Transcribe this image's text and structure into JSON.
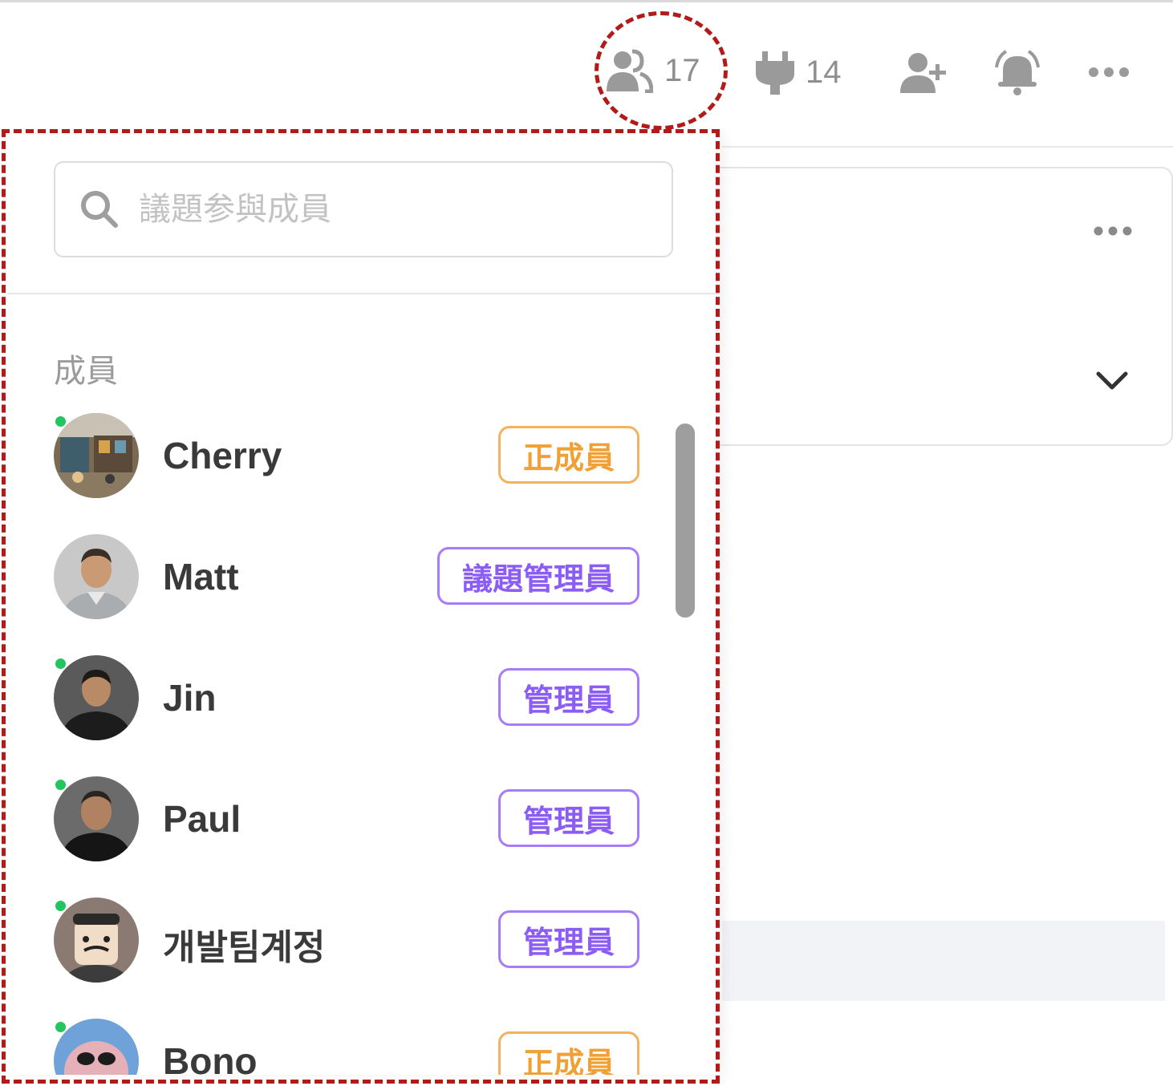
{
  "toolbar": {
    "members_count": "17",
    "integrations_count": "14"
  },
  "search": {
    "placeholder": "議題参與成員"
  },
  "section": {
    "label": "成員"
  },
  "members": [
    {
      "name": "Cherry",
      "role": "正成員",
      "online": true
    },
    {
      "name": "Matt",
      "role": "議題管理員",
      "online": false
    },
    {
      "name": "Jin",
      "role": "管理員",
      "online": true
    },
    {
      "name": "Paul",
      "role": "管理員",
      "online": true
    },
    {
      "name": "개발팀계정",
      "role": "管理員",
      "online": true
    },
    {
      "name": "Bono",
      "role": "正成員",
      "online": true
    }
  ],
  "colors": {
    "owner_badge": "#f0a034",
    "admin_badge": "#8b5cf6",
    "online": "#22c55e",
    "annotation": "#b31b1b"
  }
}
